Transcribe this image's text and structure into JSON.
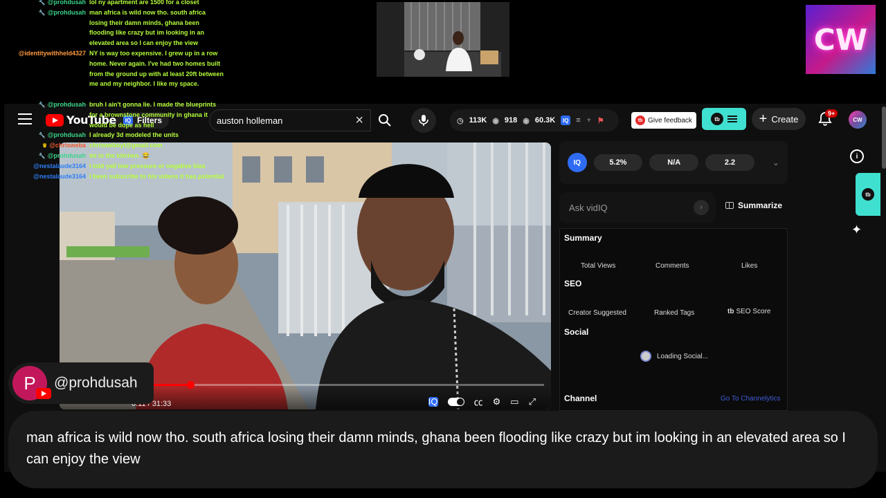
{
  "chat": [
    {
      "user": "@prohdusah",
      "badge": "wrench",
      "color": "green",
      "message": "lol ny apartment are 1500 for a closet",
      "lines": 1
    },
    {
      "user": "@prohdusah",
      "badge": "wrench",
      "color": "green",
      "message": "man africa is wild now tho. south africa losing their damn minds, ghana been flooding like crazy but im looking in an elevated area so I can enjoy the view",
      "lines": 4
    },
    {
      "user": "@identitywithheld4327",
      "badge": "",
      "color": "orange",
      "message": "NY is way too expensive. I grew up in a row home. Never again. I've had two homes built from the ground up with at least 20ft between me and my neighbor. I like my space.",
      "lines": 5
    },
    {
      "user": "@prohdusah",
      "badge": "wrench",
      "color": "green",
      "message": "bruh I ain't gonna lie. I made the blueprints for a brownstone community in ghana it would be dope as hell",
      "lines": 3
    },
    {
      "user": "@prohdusah",
      "badge": "wrench",
      "color": "green",
      "message": "I already 3d modeled the units",
      "lines": 1
    },
    {
      "user": "@chrisweba",
      "badge": "crown",
      "color": "red",
      "message": "chrisweboyt@gmail.com",
      "lines": 1
    },
    {
      "user": "@prohdusah",
      "badge": "wrench",
      "color": "green",
      "message": "im in the kitchen. 😂",
      "lines": 1
    },
    {
      "user": "@nestalaude3164",
      "badge": "",
      "color": "blue",
      "message": "I told yall low pressure or negative bias",
      "lines": 1
    },
    {
      "user": "@nestalaude3164",
      "badge": "",
      "color": "blue",
      "message": "I been subscribe to his videos it has potential",
      "lines": 2
    }
  ],
  "youtube": {
    "logo_text": "YouTube",
    "filter_label": "Filters",
    "search_value": "auston holleman",
    "stats": {
      "views": "113K",
      "watching": "918",
      "views2": "60.3K"
    },
    "feedback_label": "Give feedback",
    "create_label": "Create",
    "notif_badge": "9+",
    "avatar_text": "CW"
  },
  "player": {
    "time": "0:11 / 31:33",
    "progress": 0.26
  },
  "vidiq": {
    "badge": "IQ",
    "metrics": [
      "5.2%",
      "N/A",
      "2.2"
    ],
    "ask_placeholder": "Ask vidIQ",
    "summarize_label": "Summarize",
    "summary_title": "Summary",
    "summary_cols": [
      "Total Views",
      "Comments",
      "Likes"
    ],
    "seo_title": "SEO",
    "seo_cols": [
      "Creator Suggested",
      "Ranked Tags",
      "SEO Score"
    ],
    "social_title": "Social",
    "social_loading": "Loading Social...",
    "channel_title": "Channel",
    "channel_link": "Go To Channelytics"
  },
  "overlay": {
    "logo_text": "CW",
    "username": "@prohdusah",
    "avatar_letter": "P",
    "message": "man africa is wild now tho. south africa losing their damn minds, ghana been flooding like crazy but im looking in an elevated area so I can enjoy the view"
  },
  "colors": {
    "chat_message": "#b7ff3b",
    "accent_teal": "#40e0d0",
    "yt_red": "#ff0000"
  }
}
